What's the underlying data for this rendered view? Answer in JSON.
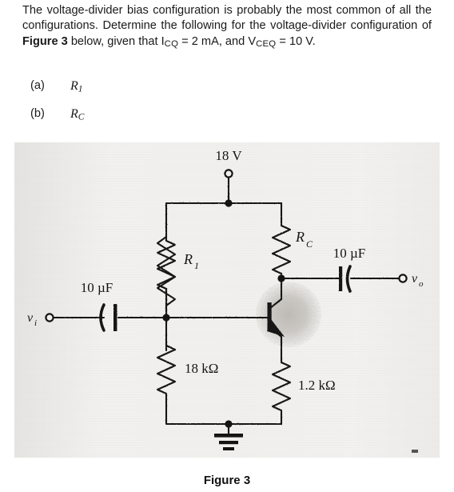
{
  "problem": {
    "line_1": "The voltage-divider bias configuration is probably the most common of all the configurations. Determine the following for the voltage-divider configuration of ",
    "figure_ref": "Figure 3",
    "line_2": " below, given that I",
    "icq_sub": "CQ",
    "line_3": " = 2 mA, and V",
    "vceq_sub": "CEQ",
    "line_4": " = 10 V."
  },
  "parts": [
    {
      "tag": "(a)",
      "symbol": "R",
      "subscript": "1"
    },
    {
      "tag": "(b)",
      "symbol": "R",
      "subscript": "C"
    }
  ],
  "figure": {
    "caption": "Figure 3",
    "supply_label": "18 V",
    "r1_label": "R",
    "r1_sub": "1",
    "rc_label": "R",
    "rc_sub": "C",
    "r2_value": "18 kΩ",
    "re_value": "1.2 kΩ",
    "cin_label": "10 µF",
    "cout_label": "10 µF",
    "input_label": "v",
    "input_sub": "i",
    "output_label": "v",
    "output_sub": "o",
    "ground_name": "ground-symbol",
    "transistor_name": "npn-transistor"
  },
  "colors": {
    "ink": "#141414",
    "paper": "#f1f0ee",
    "page": "#ffffff",
    "smudge": "#bdbab5"
  }
}
